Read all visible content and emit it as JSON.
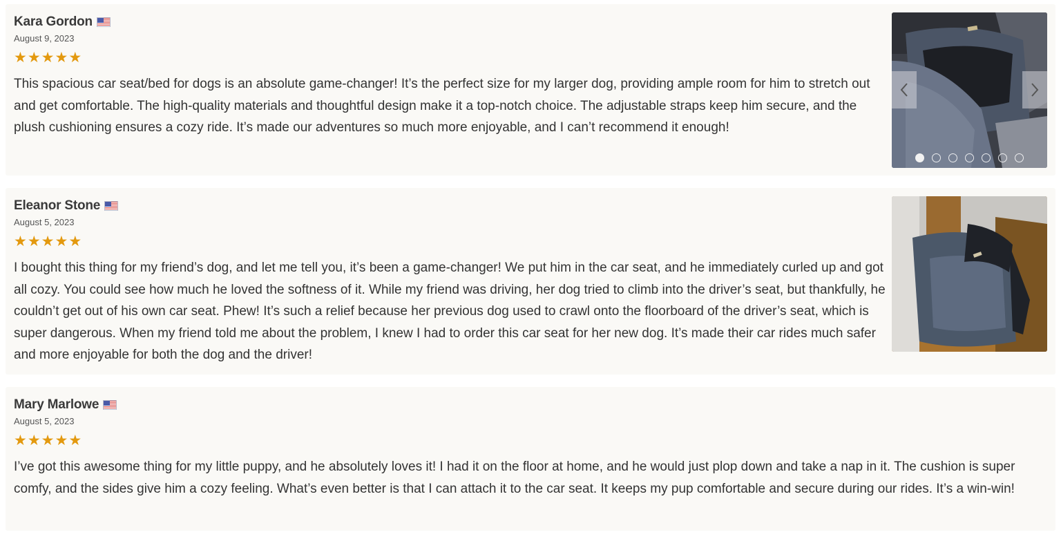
{
  "reviews": [
    {
      "name": "Kara Gordon",
      "country": "United States",
      "date": "August 9, 2023",
      "rating": 5,
      "text": "This spacious car seat/bed for dogs is an absolute game-changer! It’s the perfect size for my larger dog, providing ample room for him to stretch out and get comfortable. The high-quality materials and thoughtful design make it a top-notch choice. The adjustable straps keep him secure, and the plush cushioning ensures a cozy ride. It’s made our adventures so much more enjoyable, and I can’t recommend it enough!",
      "photos": {
        "count": 7,
        "active_index": 0
      }
    },
    {
      "name": "Eleanor Stone",
      "country": "United States",
      "date": "August 5, 2023",
      "rating": 5,
      "text": "I bought this thing for my friend’s dog, and let me tell you, it’s been a game-changer! We put him in the car seat, and he immediately curled up and got all cozy. You could see how much he loved the softness of it. While my friend was driving, her dog tried to climb into the driver’s seat, but thankfully, he couldn’t get out of his own car seat. Phew! It’s such a relief because her previous dog used to crawl onto the floorboard of the driver’s seat, which is super dangerous. When my friend told me about the problem, I knew I had to order this car seat for her new dog. It’s made their car rides much safer and more enjoyable for both the dog and the driver!",
      "photos": {
        "count": 1
      }
    },
    {
      "name": "Mary Marlowe",
      "country": "United States",
      "date": "August 5, 2023",
      "rating": 5,
      "text": "I’ve got this awesome thing for my little puppy, and he absolutely loves it! I had it on the floor at home, and he would just plop down and take a nap in it. The cushion is super comfy, and the sides give him a cozy feeling. What’s even better is that I can attach it to the car seat. It keeps my pup comfortable and secure during our rides. It’s a win-win!"
    }
  ],
  "colors": {
    "star": "#e3990f",
    "card_bg": "#faf9f6",
    "text": "#333333"
  },
  "icons": {
    "prev": "chevron-left-icon",
    "next": "chevron-right-icon",
    "flag": "us-flag-icon",
    "star": "star-icon"
  }
}
